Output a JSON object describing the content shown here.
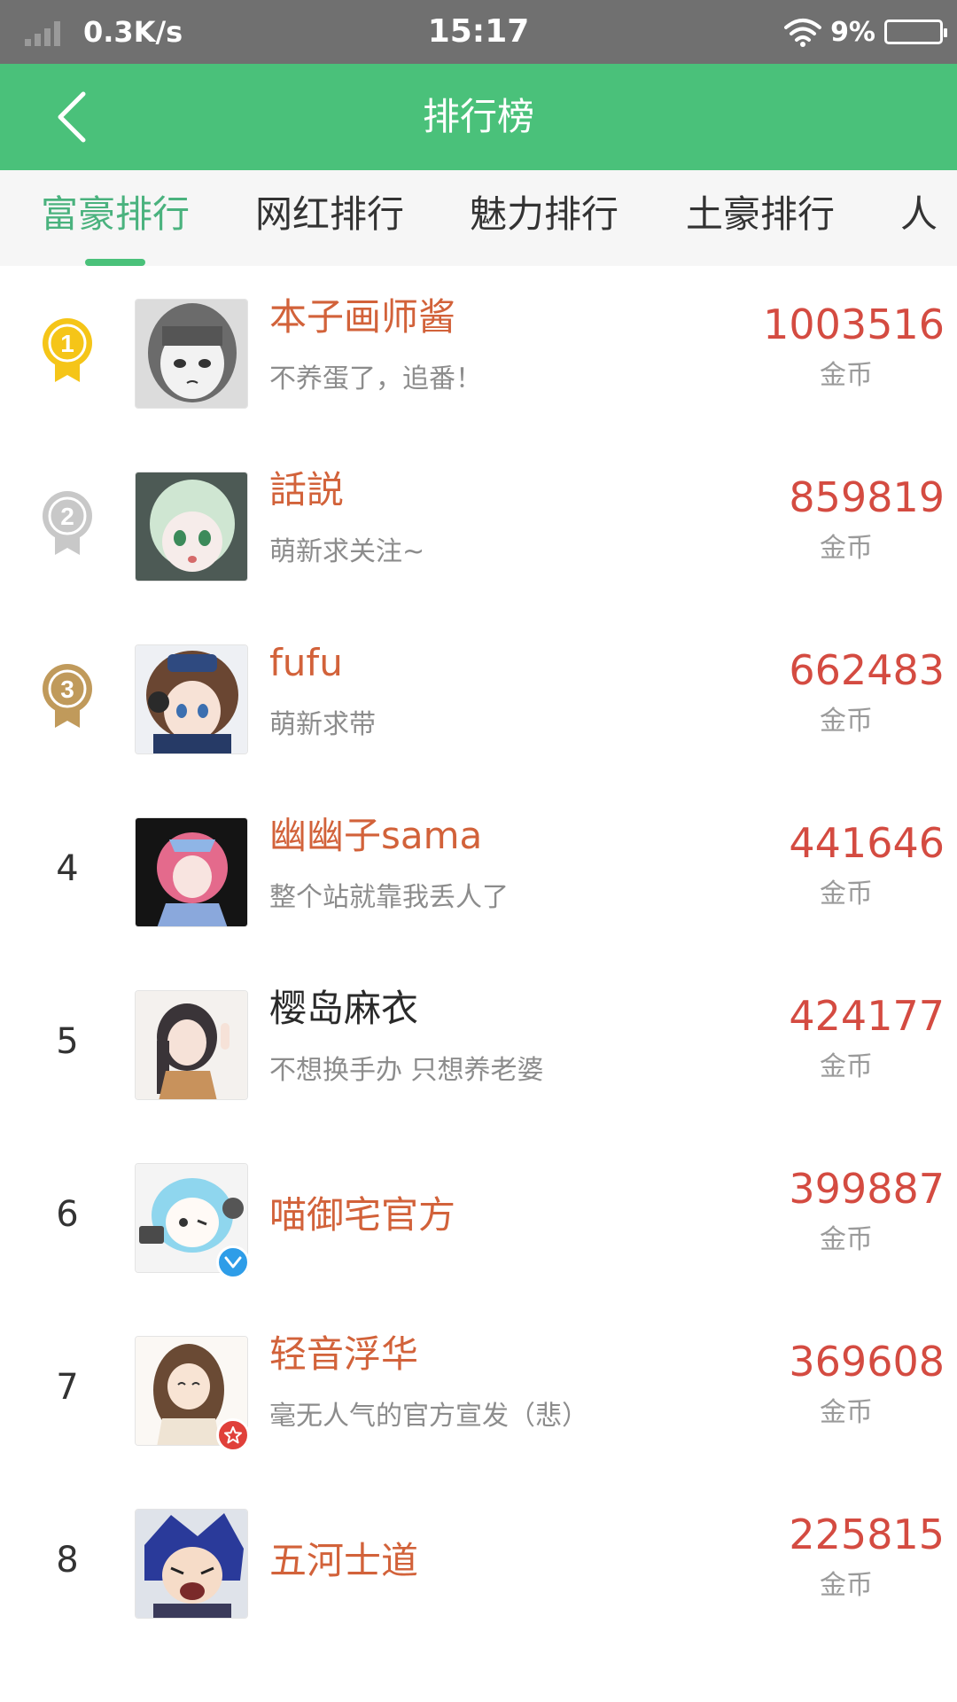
{
  "status_bar": {
    "speed": "0.3K/s",
    "time": "15:17",
    "battery": "9%",
    "icons": [
      "signal-icon",
      "wifi-icon",
      "battery-icon"
    ]
  },
  "header": {
    "title": "排行榜",
    "back_icon": "chevron-left-icon",
    "color": "#4ac17a"
  },
  "tabs": [
    {
      "label": "富豪排行",
      "active": true
    },
    {
      "label": "网红排行",
      "active": false
    },
    {
      "label": "魅力排行",
      "active": false
    },
    {
      "label": "土豪排行",
      "active": false
    },
    {
      "label": "人",
      "active": false
    }
  ],
  "ranking": [
    {
      "rank": "1",
      "medal": "gold",
      "name": "本子画师酱",
      "bio": "不养蛋了，追番！",
      "coins": "1003516",
      "unit": "金币"
    },
    {
      "rank": "2",
      "medal": "silver",
      "name": "話説",
      "bio": "萌新求关注~",
      "coins": "859819",
      "unit": "金币"
    },
    {
      "rank": "3",
      "medal": "bronze",
      "name": "fufu",
      "bio": "萌新求带",
      "coins": "662483",
      "unit": "金币"
    },
    {
      "rank": "4",
      "name": "幽幽子sama",
      "bio": "整个站就靠我丢人了",
      "coins": "441646",
      "unit": "金币"
    },
    {
      "rank": "5",
      "name": "樱岛麻衣",
      "bio": "不想换手办 只想养老婆",
      "coins": "424177",
      "unit": "金币"
    },
    {
      "rank": "6",
      "name": "喵御宅官方",
      "bio": "",
      "coins": "399887",
      "unit": "金币",
      "badge": "verified-badge-icon"
    },
    {
      "rank": "7",
      "name": "轻音浮华",
      "bio": "毫无人气的官方宣发（悲）",
      "coins": "369608",
      "unit": "金币",
      "badge": "star-badge-icon"
    },
    {
      "rank": "8",
      "name": "五河士道",
      "bio": "",
      "coins": "225815",
      "unit": "金币"
    }
  ],
  "colors": {
    "accent": "#4ac17a",
    "name": "#d2623a",
    "coins": "#d44b41",
    "gold": "#f5c518",
    "silver": "#c8c8c8",
    "bronze": "#c09a5b"
  }
}
